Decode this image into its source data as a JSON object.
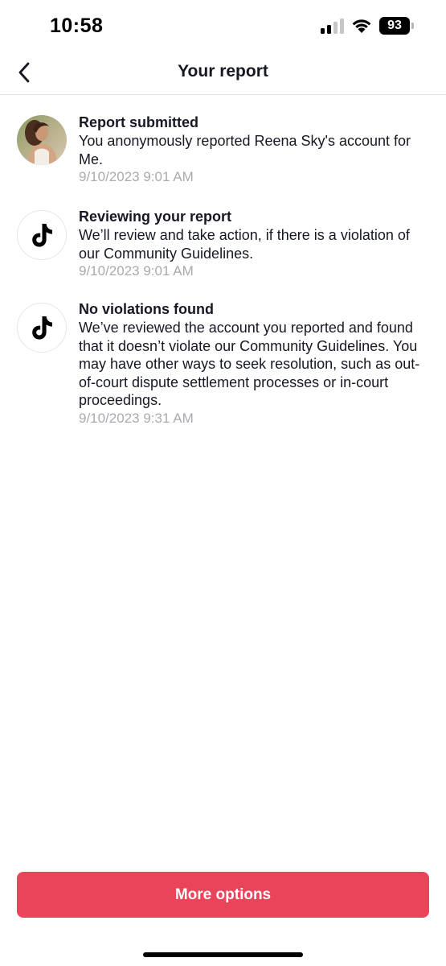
{
  "status_bar": {
    "time": "10:58",
    "battery": "93",
    "icons": [
      "cellular-signal-icon",
      "wifi-icon",
      "battery-icon"
    ]
  },
  "nav": {
    "title": "Your report",
    "back_icon": "chevron-left-icon"
  },
  "events": [
    {
      "title": "Report submitted",
      "body": "You anonymously reported Reena Sky's account for Me.",
      "time": "9/10/2023 9:01 AM",
      "icon": "avatar"
    },
    {
      "title": "Reviewing your report",
      "body": "We’ll review and take action, if there is a violation of our Community Guidelines.",
      "time": "9/10/2023 9:01 AM",
      "icon": "tiktok-logo-icon"
    },
    {
      "title": "No violations found",
      "body": "We’ve reviewed the account you reported and found that it doesn’t violate our Community Guidelines. You may have other ways to seek resolution, such as out-of-court dispute settlement processes or in-court proceedings.",
      "time": "9/10/2023 9:31 AM",
      "icon": "tiktok-logo-icon"
    }
  ],
  "footer": {
    "more_options_label": "More options"
  },
  "colors": {
    "accent": "#ea445a",
    "text_primary": "#161823",
    "text_muted": "#a9aaaf",
    "divider": "#e3e3e4"
  }
}
